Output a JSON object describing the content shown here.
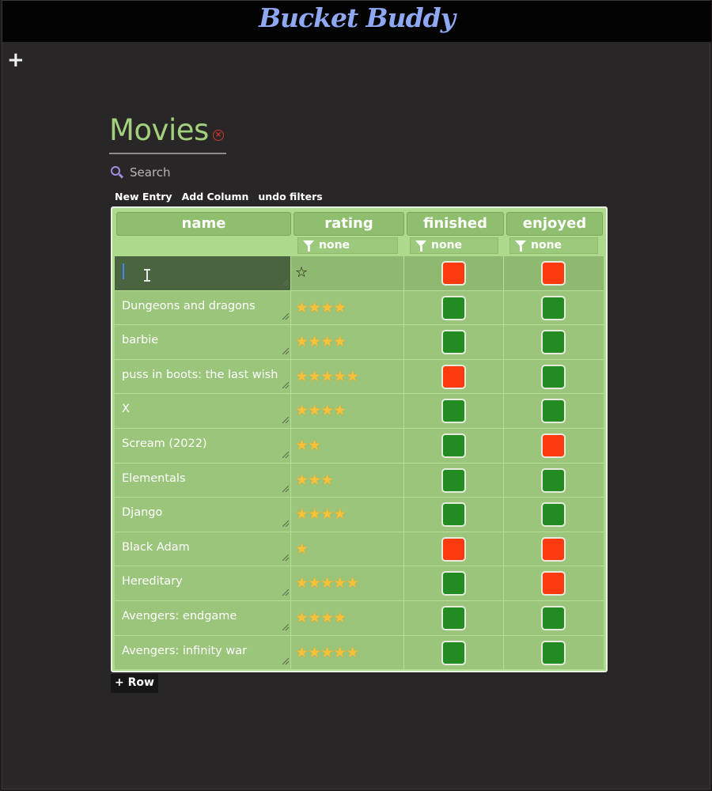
{
  "app": {
    "title": "Bucket Buddy",
    "add_list_label": "+"
  },
  "list": {
    "title": "Movies",
    "close_glyph": "×",
    "search_placeholder": "Search",
    "toolbar": {
      "new_entry": "New Entry",
      "add_column": "Add Column",
      "undo_filters": "undo filters"
    },
    "columns": [
      {
        "label": "name"
      },
      {
        "label": "rating",
        "filter": "none"
      },
      {
        "label": "finished",
        "filter": "none"
      },
      {
        "label": "enjoyed",
        "filter": "none"
      }
    ],
    "rows": [
      {
        "name": "",
        "rating": 0,
        "finished": false,
        "enjoyed": false
      },
      {
        "name": "Dungeons and dragons",
        "rating": 4,
        "finished": true,
        "enjoyed": true
      },
      {
        "name": "barbie",
        "rating": 4,
        "finished": true,
        "enjoyed": true
      },
      {
        "name": "puss in boots: the last wish",
        "rating": 5,
        "finished": false,
        "enjoyed": true
      },
      {
        "name": "X",
        "rating": 4,
        "finished": true,
        "enjoyed": true
      },
      {
        "name": "Scream (2022)",
        "rating": 2,
        "finished": true,
        "enjoyed": false
      },
      {
        "name": "Elementals",
        "rating": 3,
        "finished": true,
        "enjoyed": true
      },
      {
        "name": "Django",
        "rating": 4,
        "finished": true,
        "enjoyed": true
      },
      {
        "name": "Black Adam",
        "rating": 1,
        "finished": false,
        "enjoyed": false
      },
      {
        "name": "Hereditary",
        "rating": 5,
        "finished": true,
        "enjoyed": false
      },
      {
        "name": "Avengers: endgame",
        "rating": 4,
        "finished": true,
        "enjoyed": true
      },
      {
        "name": "Avengers: infinity war",
        "rating": 5,
        "finished": true,
        "enjoyed": true
      }
    ],
    "add_row_label": "+ Row"
  },
  "colors": {
    "accent_title": "#a2d07c",
    "app_title": "#8fa8f2",
    "toggle_on": "#228b22",
    "toggle_off": "#fb3a10"
  }
}
